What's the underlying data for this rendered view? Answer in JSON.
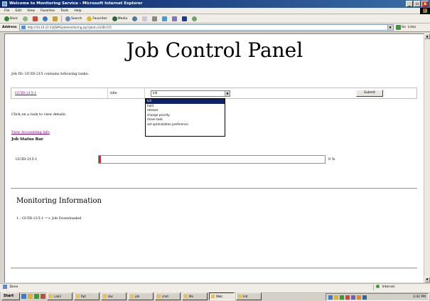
{
  "window": {
    "title": "Welcome to Monitoring Service - Microsoft Internet Explorer",
    "controls": {
      "minimize": "_",
      "restore": "▫",
      "close": "x"
    }
  },
  "menubar": [
    "File",
    "Edit",
    "View",
    "Favorites",
    "Tools",
    "Help"
  ],
  "toolbar": {
    "back": "Back",
    "search": "Search",
    "favorites": "Favorites",
    "media": "Media",
    "address_label": "Address",
    "url": "http://10.10.22.33/JSMS/jobmonitoring.jsp?jobid=GUID-215",
    "go": "Go",
    "links": "Links"
  },
  "page": {
    "title": "Job Control Panel",
    "intro": "Job ID: GUID-215 contains following tasks:",
    "task": {
      "name": "GUID-215-1",
      "status": "Idle"
    },
    "action_select": {
      "selected": "kill",
      "options": [
        "kill",
        "hold",
        "release",
        "change priority",
        "move task",
        "set optimization preference"
      ]
    },
    "submit_label": "Submit",
    "click_hint": "Click on a task to view details.",
    "accounting_link": "View Accounting info",
    "status_bar_heading": "Job Status Bar",
    "progress": {
      "task": "GUID-215-1",
      "percent_value": 0,
      "percent_label": "0 %"
    },
    "monitoring_heading": "Monitoring Information",
    "monitoring_entries": [
      "1 : GUID-215-1 => Job Downloaded"
    ]
  },
  "statusbar": {
    "left": "Done",
    "zone": "Internet"
  },
  "taskbar": {
    "start": "Start",
    "buttons": [
      "Lab3",
      "Rpt",
      "doc",
      "job",
      "cmd",
      "Mo",
      "Welc",
      "Intr"
    ],
    "active_index": 6,
    "clock": "3:42 PM"
  }
}
